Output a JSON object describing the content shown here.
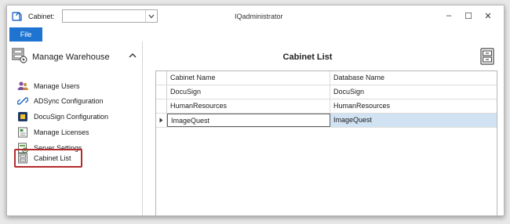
{
  "titlebar": {
    "cabinet_label": "Cabinet:",
    "cabinet_value": "",
    "window_title": "IQadministrator",
    "minimize": "–",
    "maximize": "☐",
    "close": "✕"
  },
  "ribbon": {
    "file_tab": "File"
  },
  "sidebar": {
    "header": "Manage Warehouse",
    "items": [
      {
        "label": "Manage Users",
        "icon": "users-icon"
      },
      {
        "label": "ADSync Configuration",
        "icon": "link-icon"
      },
      {
        "label": "DocuSign Configuration",
        "icon": "docusign-icon"
      },
      {
        "label": "Manage Licenses",
        "icon": "license-icon"
      },
      {
        "label": "Server Settings",
        "icon": "server-settings-icon"
      },
      {
        "label": "Cabinet List",
        "icon": "cabinet-icon"
      }
    ],
    "selected": "Cabinet List"
  },
  "main": {
    "title": "Cabinet List",
    "columns": [
      "Cabinet Name",
      "Database Name"
    ],
    "rows": [
      {
        "cabinet": "DocuSign",
        "database": "DocuSign"
      },
      {
        "cabinet": "HumanResources",
        "database": "HumanResources"
      },
      {
        "cabinet": "ImageQuest",
        "database": "ImageQuest"
      }
    ],
    "selected_row": 2
  },
  "colors": {
    "accent": "#1e74d0",
    "selection_highlight": "#d1e3f3",
    "callout_border": "#b42b2b"
  }
}
